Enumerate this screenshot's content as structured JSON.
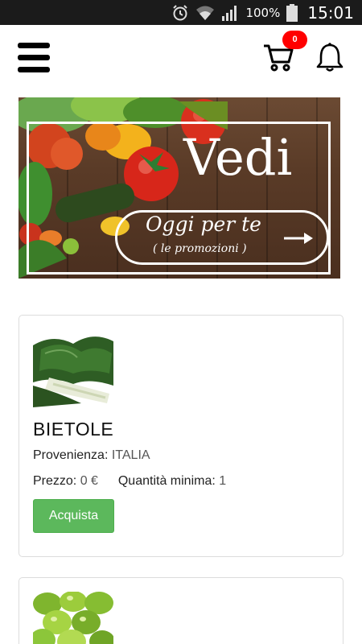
{
  "status_bar": {
    "battery_percent": "100%",
    "time": "15:01",
    "icons": [
      "alarm-icon",
      "wifi-icon",
      "signal-icon",
      "battery-icon"
    ]
  },
  "header": {
    "menu_icon": "hamburger-menu-icon",
    "cart_icon": "shopping-cart-icon",
    "cart_count": "0",
    "bell_icon": "notification-bell-icon",
    "badge_color": "#ff0000"
  },
  "banner": {
    "title": "Vedi",
    "subtitle": "Oggi per te",
    "caption": "( le promozioni )"
  },
  "products": [
    {
      "name": "BIETOLE",
      "origin_label": "Provenienza:",
      "origin_value": "ITALIA",
      "price_label": "Prezzo:",
      "price_value": "0 €",
      "min_qty_label": "Quantità minima:",
      "min_qty_value": "1",
      "buy_label": "Acquista"
    },
    {
      "image": "green-figs"
    }
  ],
  "colors": {
    "buy_button": "#5cb85c",
    "status_bar": "#1b1b1b"
  }
}
